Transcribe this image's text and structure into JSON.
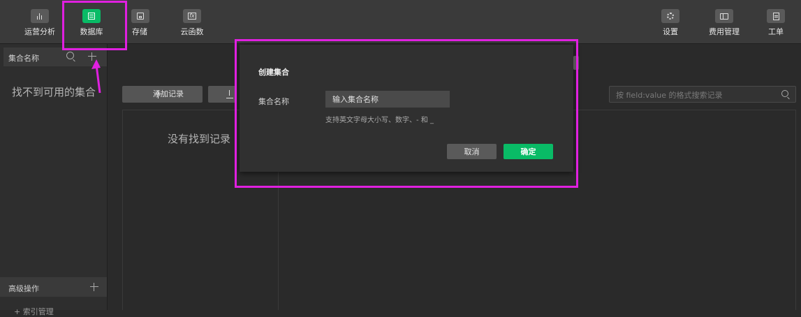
{
  "toolbar": {
    "left": [
      {
        "label": "运营分析",
        "icon": "analytics-icon"
      },
      {
        "label": "数据库",
        "icon": "database-icon",
        "active": true
      },
      {
        "label": "存储",
        "icon": "storage-icon"
      },
      {
        "label": "云函数",
        "icon": "cloud-function-icon"
      }
    ],
    "right": [
      {
        "label": "设置",
        "icon": "settings-icon"
      },
      {
        "label": "费用管理",
        "icon": "billing-icon"
      },
      {
        "label": "工单",
        "icon": "ticket-icon"
      }
    ]
  },
  "sidebar": {
    "header_title": "集合名称",
    "empty_text": "找不到可用的集合",
    "advanced_title": "高级操作",
    "advanced_item": "+ 索引管理"
  },
  "main": {
    "add_record_label": "添加记录",
    "empty_text": "没有找到记录",
    "search_placeholder": "按 field:value 的格式搜索记录"
  },
  "dialog": {
    "title": "创建集合",
    "field_label": "集合名称",
    "input_placeholder": "输入集合名称",
    "input_value": "",
    "hint": "支持英文字母大小写、数字、- 和 _",
    "cancel_label": "取消",
    "confirm_label": "确定"
  },
  "colors": {
    "accent": "#09bb66",
    "annotation": "#e020e0",
    "background": "#2a2a2a",
    "toolbar": "#3a3a3a"
  }
}
